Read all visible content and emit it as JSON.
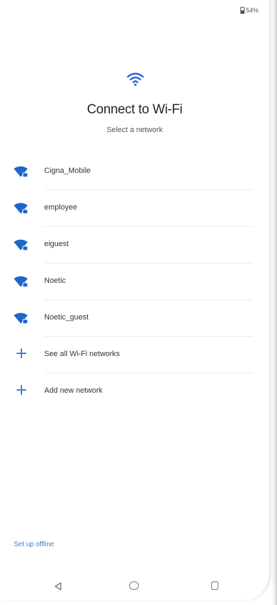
{
  "status_bar": {
    "battery_text": "54%",
    "battery_icon": "battery-icon"
  },
  "header": {
    "icon": "wifi-icon",
    "title": "Connect to Wi-Fi",
    "subtitle": "Select a network"
  },
  "networks": [
    {
      "name": "Cigna_Mobile",
      "icon": "wifi-locked-icon"
    },
    {
      "name": "employee",
      "icon": "wifi-locked-icon"
    },
    {
      "name": "eiguest",
      "icon": "wifi-locked-icon"
    },
    {
      "name": "Noetic",
      "icon": "wifi-locked-icon"
    },
    {
      "name": "Noetic_guest",
      "icon": "wifi-locked-icon"
    }
  ],
  "actions": {
    "see_all": "See all Wi-Fi networks",
    "add_new": "Add new network"
  },
  "footer": {
    "setup_offline": "Set up offline"
  },
  "nav": {
    "back": "back-icon",
    "home": "home-icon",
    "recents": "recents-icon"
  },
  "colors": {
    "accent": "#3c7fd6",
    "wifi_icon": "#1e66c9",
    "text": "#333333"
  }
}
